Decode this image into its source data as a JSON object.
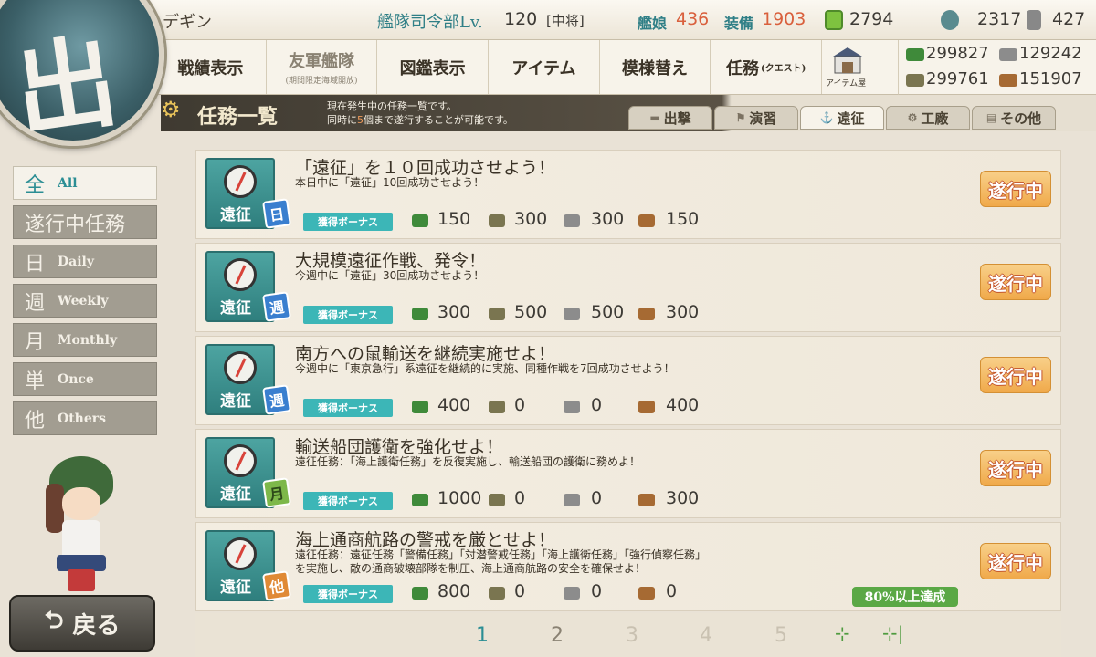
{
  "header": {
    "admiral_name": "デギン",
    "hq_label": "艦隊司令部Lv.",
    "hq_level": "120",
    "rank": "[中将]",
    "ships_label": "艦娘",
    "ships_count": "436",
    "equip_label": "装備",
    "equip_count": "1903",
    "buckets": "2794",
    "dev_materials": "2317",
    "screws": "427"
  },
  "emblem_glyph": "出",
  "nav": {
    "record": "戦績表示",
    "friend_fleet": "友軍艦隊",
    "friend_fleet_sub": "(期間限定海域開放)",
    "encyclopedia": "図鑑表示",
    "items": "アイテム",
    "remodel": "模様替え",
    "quests": "任務",
    "quests_small": "(クエスト)",
    "shop_label": "アイテム屋"
  },
  "materials": {
    "fuel": "299827",
    "steel": "129242",
    "ammo": "299761",
    "bauxite": "151907"
  },
  "quest_header": {
    "title": "任務一覧",
    "note_line1": "現在発生中の任務一覧です。",
    "note_line2_pre": "同時に",
    "note_line2_num": "5",
    "note_line2_post": "個まで遂行することが可能です。"
  },
  "category_tabs": [
    {
      "label": "出撃",
      "icon": "ship-icon"
    },
    {
      "label": "演習",
      "icon": "exercise-icon"
    },
    {
      "label": "遠征",
      "icon": "expedition-icon"
    },
    {
      "label": "工廠",
      "icon": "factory-icon"
    },
    {
      "label": "その他",
      "icon": "other-icon"
    }
  ],
  "filters": [
    {
      "kanji": "全",
      "en": "All"
    },
    {
      "label": "遂行中任務"
    },
    {
      "kanji": "日",
      "en": "Daily"
    },
    {
      "kanji": "週",
      "en": "Weekly"
    },
    {
      "kanji": "月",
      "en": "Monthly"
    },
    {
      "kanji": "単",
      "en": "Once"
    },
    {
      "kanji": "他",
      "en": "Others"
    }
  ],
  "quests": [
    {
      "icon_label": "遠征",
      "freq": "日",
      "name": "「遠征」を１０回成功させよう！",
      "desc": "本日中に「遠征」10回成功させよう！",
      "bonus": "獲得ボーナス",
      "fuel": "150",
      "ammo": "300",
      "steel": "300",
      "bauxite": "150",
      "status": "遂行中"
    },
    {
      "icon_label": "遠征",
      "freq": "週",
      "name": "大規模遠征作戦、発令！",
      "desc": "今週中に「遠征」30回成功させよう！",
      "bonus": "獲得ボーナス",
      "fuel": "300",
      "ammo": "500",
      "steel": "500",
      "bauxite": "300",
      "status": "遂行中"
    },
    {
      "icon_label": "遠征",
      "freq": "週",
      "name": "南方への鼠輸送を継続実施せよ！",
      "desc": "今週中に「東京急行」系遠征を継続的に実施、同種作戦を7回成功させよう！",
      "bonus": "獲得ボーナス",
      "fuel": "400",
      "ammo": "0",
      "steel": "0",
      "bauxite": "400",
      "status": "遂行中"
    },
    {
      "icon_label": "遠征",
      "freq": "月",
      "name": "輸送船団護衛を強化せよ！",
      "desc": "遠征任務：「海上護衛任務」を反復実施し、輸送船団の護衛に務めよ！",
      "bonus": "獲得ボーナス",
      "fuel": "1000",
      "ammo": "0",
      "steel": "0",
      "bauxite": "300",
      "status": "遂行中"
    },
    {
      "icon_label": "遠征",
      "freq": "他",
      "name": "海上通商航路の警戒を厳とせよ！",
      "desc": "遠征任務：遠征任務「警備任務」「対潜警戒任務」「海上護衛任務」「強行偵察任務」",
      "desc2": "を実施し、敵の通商破壊部隊を制圧、海上通商航路の安全を確保せよ！",
      "bonus": "獲得ボーナス",
      "fuel": "800",
      "ammo": "0",
      "steel": "0",
      "bauxite": "0",
      "status": "遂行中",
      "progress": "80%以上達成"
    }
  ],
  "pagination": {
    "pages": [
      "1",
      "2",
      "3",
      "4",
      "5"
    ],
    "current": "1",
    "next": "⊹",
    "last": "⊹|"
  },
  "back_label": "戻る",
  "colors": {
    "accent_teal": "#2b8e94",
    "status_orange": "#f0a94a",
    "progress_green": "#5aa845",
    "daily_badge": "#3a7fcf",
    "weekly_badge": "#3a7fcf",
    "monthly_badge": "#7db84a",
    "other_badge": "#e08a36"
  }
}
